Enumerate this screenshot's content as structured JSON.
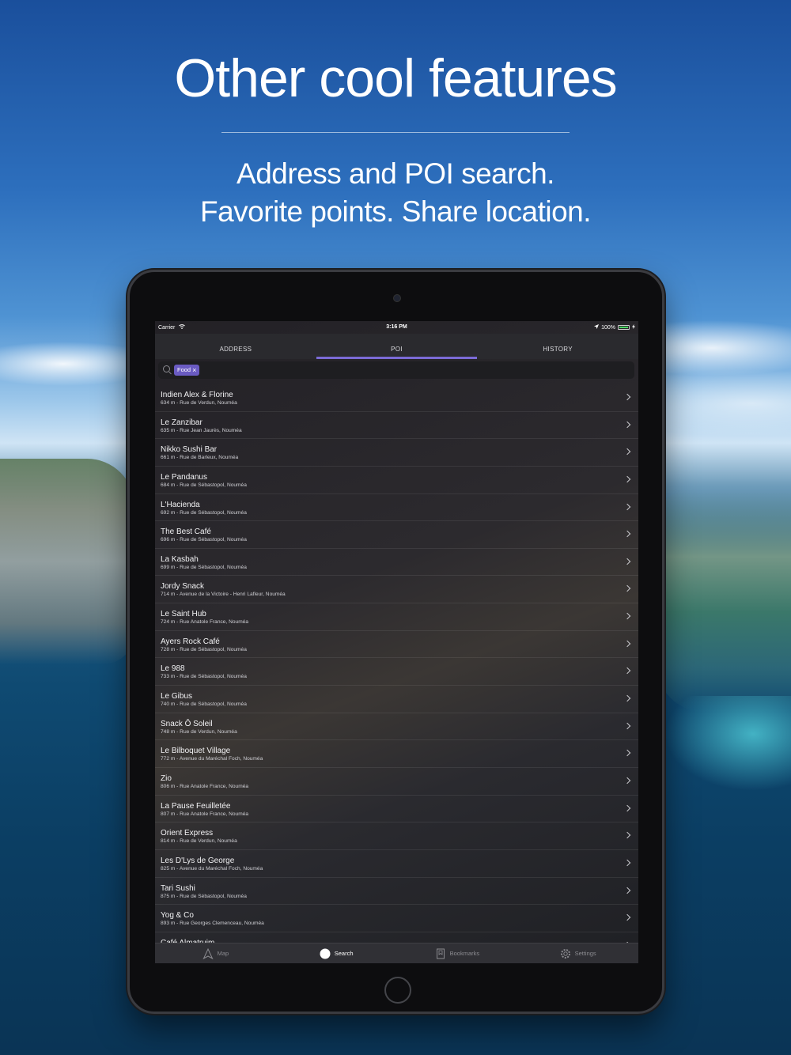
{
  "hero": {
    "title": "Other cool features",
    "subtitle_line1": "Address and POI search.",
    "subtitle_line2": "Favorite points. Share location."
  },
  "status_bar": {
    "carrier": "Carrier",
    "time": "3:16 PM",
    "battery": "100%"
  },
  "tabs": [
    "ADDRESS",
    "POI",
    "HISTORY"
  ],
  "active_tab": "POI",
  "search": {
    "chip_label": "Food",
    "chip_remove": "×"
  },
  "results": [
    {
      "name": "Indien Alex & Florine",
      "detail": "634 m - Rue de Verdun, Nouméa"
    },
    {
      "name": "Le Zanzibar",
      "detail": "635 m - Rue Jean Jaurès, Nouméa"
    },
    {
      "name": "Nikko Sushi Bar",
      "detail": "661 m - Rue de Barleux, Nouméa"
    },
    {
      "name": "Le Pandanus",
      "detail": "684 m - Rue de Sébastopol, Nouméa"
    },
    {
      "name": "L'Hacienda",
      "detail": "692 m - Rue de Sébastopol, Nouméa"
    },
    {
      "name": "The Best Café",
      "detail": "696 m - Rue de Sébastopol, Nouméa"
    },
    {
      "name": "La Kasbah",
      "detail": "699 m - Rue de Sébastopol, Nouméa"
    },
    {
      "name": "Jordy Snack",
      "detail": "714 m - Avenue de la Victoire - Henri Lafleur, Nouméa"
    },
    {
      "name": "Le Saint Hub",
      "detail": "724 m - Rue Anatole France, Nouméa"
    },
    {
      "name": "Ayers Rock Café",
      "detail": "728 m - Rue de Sébastopol, Nouméa"
    },
    {
      "name": "Le 988",
      "detail": "733 m - Rue de Sébastopol, Nouméa"
    },
    {
      "name": "Le Gibus",
      "detail": "740 m - Rue de Sébastopol, Nouméa"
    },
    {
      "name": "Snack Ô Soleil",
      "detail": "748 m - Rue de Verdun, Nouméa"
    },
    {
      "name": "Le Bilboquet Village",
      "detail": "772 m - Avenue du Maréchal Foch, Nouméa"
    },
    {
      "name": "Zio",
      "detail": "806 m - Rue Anatole France, Nouméa"
    },
    {
      "name": "La Pause Feuilletée",
      "detail": "807 m - Rue Anatole France, Nouméa"
    },
    {
      "name": "Orient Express",
      "detail": "814 m - Rue de Verdun, Nouméa"
    },
    {
      "name": "Les D'Lys de George",
      "detail": "825 m - Avenue du Maréchal Foch, Nouméa"
    },
    {
      "name": "Tari Sushi",
      "detail": "875 m - Rue de Sébastopol, Nouméa"
    },
    {
      "name": "Yog & Co",
      "detail": "893 m - Rue Georges Clemenceau, Nouméa"
    },
    {
      "name": "Café Almatruim",
      "detail": ""
    }
  ],
  "tabbar": [
    {
      "label": "Map",
      "icon": "map-arrow-icon"
    },
    {
      "label": "Search",
      "icon": "search-circle-icon"
    },
    {
      "label": "Bookmarks",
      "icon": "bookmark-icon"
    },
    {
      "label": "Settings",
      "icon": "gear-icon"
    }
  ],
  "active_tabbar": "Search",
  "colors": {
    "accent": "#7b6bd6",
    "chip": "#6a5bc2",
    "battery": "#4cd964"
  }
}
